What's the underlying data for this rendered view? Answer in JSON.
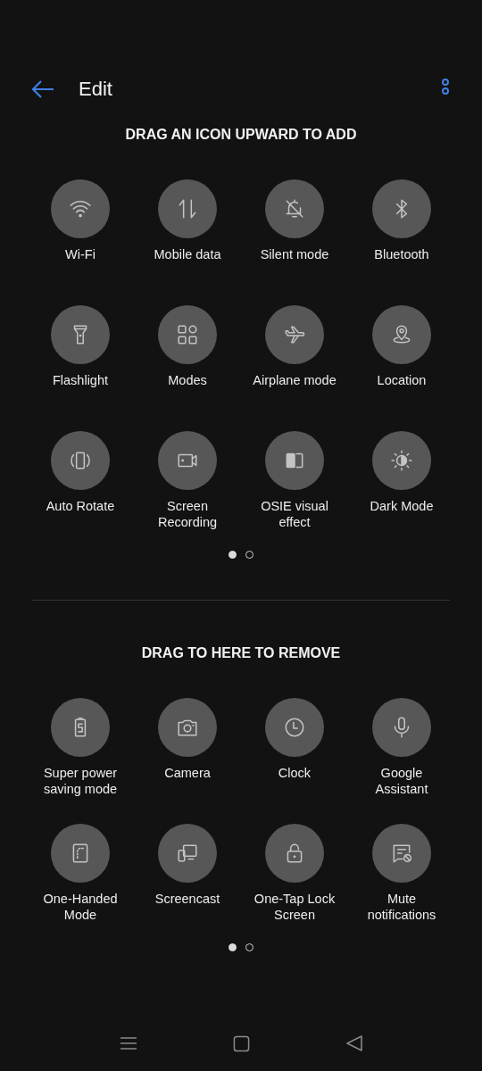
{
  "header": {
    "title": "Edit"
  },
  "add_section": {
    "title": "DRAG AN ICON UPWARD TO ADD",
    "tiles": [
      {
        "label": "Wi-Fi",
        "kind": "wifi"
      },
      {
        "label": "Mobile data",
        "kind": "data"
      },
      {
        "label": "Silent mode",
        "kind": "silent"
      },
      {
        "label": "Bluetooth",
        "kind": "bluetooth"
      },
      {
        "label": "Flashlight",
        "kind": "flashlight"
      },
      {
        "label": "Modes",
        "kind": "modes"
      },
      {
        "label": "Airplane mode",
        "kind": "airplane"
      },
      {
        "label": "Location",
        "kind": "location"
      },
      {
        "label": "Auto Rotate",
        "kind": "rotate"
      },
      {
        "label": "Screen Recording",
        "kind": "record"
      },
      {
        "label": "OSIE visual effect",
        "kind": "osie"
      },
      {
        "label": "Dark Mode",
        "kind": "dark"
      }
    ],
    "pages": [
      {
        "selected": true
      },
      {
        "selected": false
      }
    ]
  },
  "remove_section": {
    "title": "DRAG TO HERE TO REMOVE",
    "tiles": [
      {
        "label": "Super power saving mode",
        "kind": "battery"
      },
      {
        "label": "Camera",
        "kind": "camera"
      },
      {
        "label": "Clock",
        "kind": "clock"
      },
      {
        "label": "Google Assistant",
        "kind": "mic"
      },
      {
        "label": "One-Handed Mode",
        "kind": "onehand"
      },
      {
        "label": "Screencast",
        "kind": "screencast"
      },
      {
        "label": "One-Tap Lock Screen",
        "kind": "lock"
      },
      {
        "label": "Mute notifications",
        "kind": "mute"
      }
    ],
    "pages": [
      {
        "selected": true
      },
      {
        "selected": false
      }
    ]
  }
}
